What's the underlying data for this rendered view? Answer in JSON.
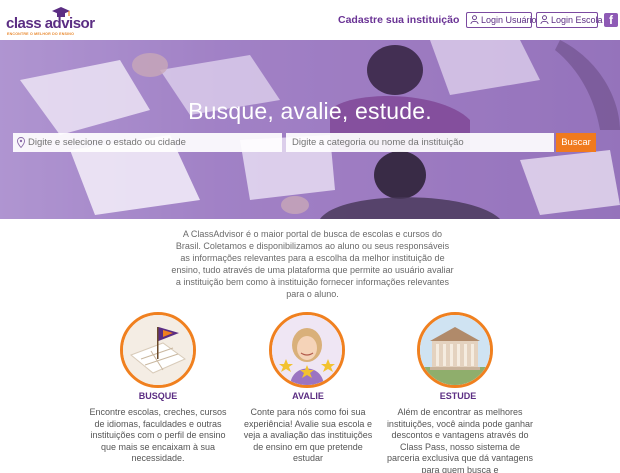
{
  "header": {
    "logo_word": "class advisor",
    "logo_tagline": "ENCONTRE O MELHOR DO ENSINO",
    "signup_link": "Cadastre sua instituição",
    "login_user": "Login Usuário",
    "login_school": "Login Escola",
    "facebook_glyph": "f"
  },
  "hero": {
    "title": "Busque, avalie, estude.",
    "state_placeholder": "Digite e selecione o estado ou cidade",
    "category_placeholder": "Digite a categoria ou nome da instituição",
    "search_button": "Buscar"
  },
  "intro": {
    "text": "A ClassAdvisor é o maior portal de busca de escolas e cursos do Brasil. Coletamos e disponibilizamos ao aluno ou seus responsáveis as informações relevantes para a escolha da melhor instituição de ensino, tudo através de uma plataforma que permite ao usuário avaliar a instituição bem como à instituição fornecer informações relevantes para o aluno."
  },
  "features": [
    {
      "title": "BUSQUE",
      "icon": "map-flag-icon",
      "text": "Encontre escolas, creches, cursos de idiomas, faculdades e outras instituições com o perfil de ensino que mais se encaixam à sua necessidade."
    },
    {
      "title": "AVALIE",
      "icon": "smiling-woman-stars-icon",
      "text": "Conte para nós como foi sua experiência! Avalie sua escola e veja a avaliação das instituições de ensino em que pretende estudar"
    },
    {
      "title": "ESTUDE",
      "icon": "school-building-icon",
      "text": "Além de encontrar as melhores instituições, você ainda pode ganhar descontos e vantagens através do Class Pass, nosso sistema de parceria exclusiva que dá vantagens para quem busca e"
    }
  ],
  "colors": {
    "brand_purple": "#5b2d83",
    "accent_orange": "#f07a1e",
    "hero_overlay": "#9d7cc3"
  }
}
